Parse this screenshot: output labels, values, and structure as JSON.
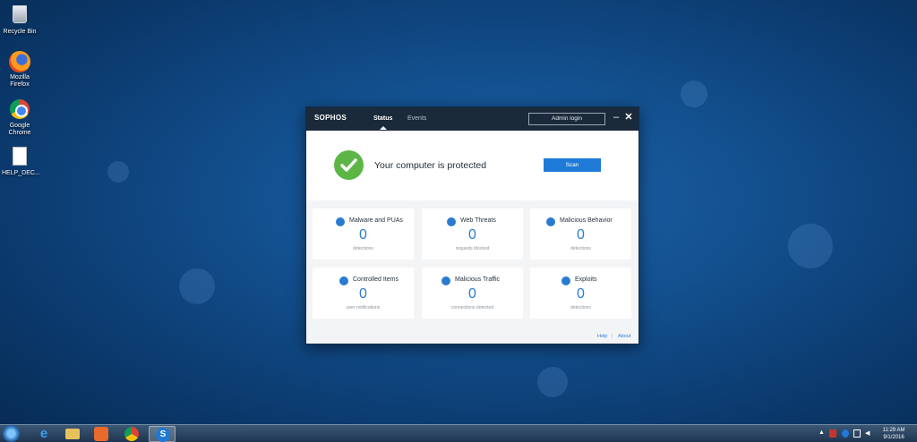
{
  "desktop": {
    "icons": [
      {
        "label": "Recycle Bin",
        "icon": "recycle-bin-icon"
      },
      {
        "label": "Mozilla Firefox",
        "icon": "firefox-icon"
      },
      {
        "label": "Google Chrome",
        "icon": "chrome-icon"
      },
      {
        "label": "HELP_DEC...",
        "icon": "document-icon"
      }
    ]
  },
  "window": {
    "logo": "SOPHOS",
    "tabs": [
      {
        "label": "Status",
        "active": true
      },
      {
        "label": "Events",
        "active": false
      }
    ],
    "admin_login": "Admin login",
    "minimize": "–",
    "close": "✕",
    "status_text": "Your computer is protected",
    "scan_label": "Scan",
    "cards": [
      {
        "title": "Malware and PUAs",
        "value": "0",
        "sub": "detections",
        "icon": "crosshair-icon"
      },
      {
        "title": "Web Threats",
        "value": "0",
        "sub": "requests blocked",
        "icon": "globe-icon"
      },
      {
        "title": "Malicious Behavior",
        "value": "0",
        "sub": "detections",
        "icon": "behavior-icon"
      },
      {
        "title": "Controlled Items",
        "value": "0",
        "sub": "user notifications",
        "icon": "wrench-icon"
      },
      {
        "title": "Malicious Traffic",
        "value": "0",
        "sub": "connections detected",
        "icon": "warning-icon"
      },
      {
        "title": "Exploits",
        "value": "0",
        "sub": "detections",
        "icon": "block-icon"
      }
    ],
    "footer": {
      "help": "Help",
      "separator": "|",
      "about": "About"
    }
  },
  "taskbar": {
    "items": [
      "internet-explorer-icon",
      "file-explorer-icon",
      "media-player-icon",
      "chrome-icon",
      "sophos-icon"
    ],
    "clock_time": "11:29 AM",
    "clock_date": "9/1/2016"
  },
  "colors": {
    "accent": "#1e7ad6",
    "success": "#5cb646",
    "titlebar": "#1b2a3a"
  }
}
